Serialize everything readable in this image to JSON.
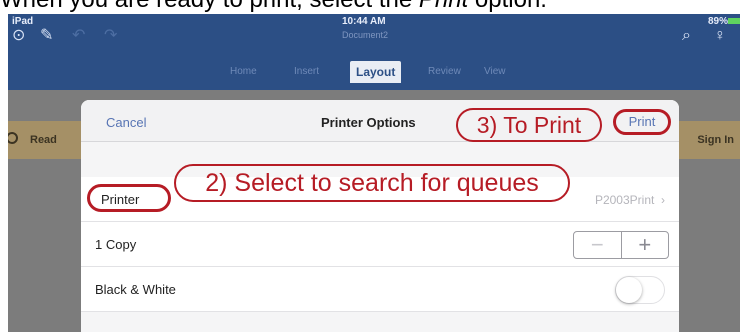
{
  "caption": {
    "text_before": "When you are ready to print, select the ",
    "text_italic": "Print",
    "text_after": " option."
  },
  "status_bar": {
    "left": "iPad",
    "time": "10:44 AM",
    "battery": "89%"
  },
  "document_title": "Document2",
  "ribbon": {
    "tabs": [
      "Home",
      "Insert",
      "Layout",
      "Review",
      "View"
    ],
    "active_tab": "Layout"
  },
  "banner": {
    "left": "Read",
    "right": "Sign In"
  },
  "printer_options": {
    "cancel_label": "Cancel",
    "title": "Printer Options",
    "print_label": "Print",
    "rows": {
      "printer_label": "Printer",
      "printer_value": "P2003Print",
      "copies_label": "1 Copy",
      "color_label": "Black & White"
    }
  },
  "annotations": {
    "to_print": "3) To Print",
    "select_queue": "2) Select to search for queues"
  },
  "colors": {
    "annotation_red": "#b61c25",
    "topbar_blue": "#2c4f85",
    "link_blue": "#5875b4"
  }
}
